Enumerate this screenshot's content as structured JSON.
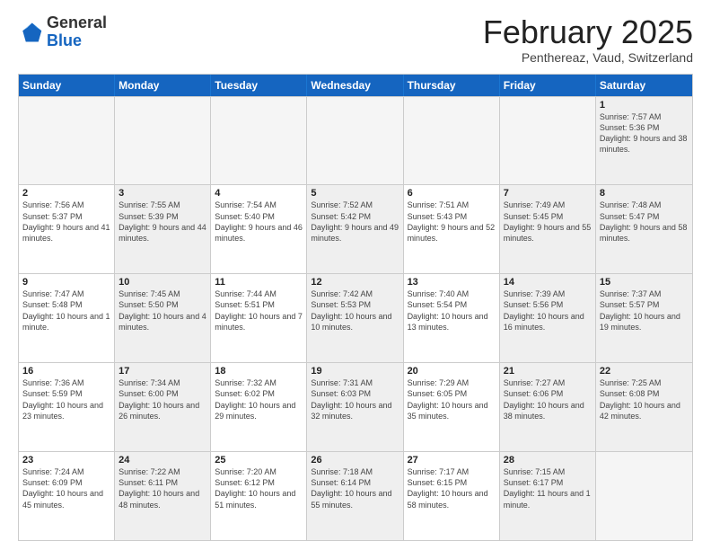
{
  "logo": {
    "general": "General",
    "blue": "Blue"
  },
  "header": {
    "title": "February 2025",
    "subtitle": "Penthereaz, Vaud, Switzerland"
  },
  "days_of_week": [
    "Sunday",
    "Monday",
    "Tuesday",
    "Wednesday",
    "Thursday",
    "Friday",
    "Saturday"
  ],
  "weeks": [
    [
      {
        "day": "",
        "info": "",
        "empty": true
      },
      {
        "day": "",
        "info": "",
        "empty": true
      },
      {
        "day": "",
        "info": "",
        "empty": true
      },
      {
        "day": "",
        "info": "",
        "empty": true
      },
      {
        "day": "",
        "info": "",
        "empty": true
      },
      {
        "day": "",
        "info": "",
        "empty": true
      },
      {
        "day": "1",
        "info": "Sunrise: 7:57 AM\nSunset: 5:36 PM\nDaylight: 9 hours and 38 minutes.",
        "shaded": true
      }
    ],
    [
      {
        "day": "2",
        "info": "Sunrise: 7:56 AM\nSunset: 5:37 PM\nDaylight: 9 hours and 41 minutes."
      },
      {
        "day": "3",
        "info": "Sunrise: 7:55 AM\nSunset: 5:39 PM\nDaylight: 9 hours and 44 minutes.",
        "shaded": true
      },
      {
        "day": "4",
        "info": "Sunrise: 7:54 AM\nSunset: 5:40 PM\nDaylight: 9 hours and 46 minutes."
      },
      {
        "day": "5",
        "info": "Sunrise: 7:52 AM\nSunset: 5:42 PM\nDaylight: 9 hours and 49 minutes.",
        "shaded": true
      },
      {
        "day": "6",
        "info": "Sunrise: 7:51 AM\nSunset: 5:43 PM\nDaylight: 9 hours and 52 minutes."
      },
      {
        "day": "7",
        "info": "Sunrise: 7:49 AM\nSunset: 5:45 PM\nDaylight: 9 hours and 55 minutes.",
        "shaded": true
      },
      {
        "day": "8",
        "info": "Sunrise: 7:48 AM\nSunset: 5:47 PM\nDaylight: 9 hours and 58 minutes.",
        "shaded": true
      }
    ],
    [
      {
        "day": "9",
        "info": "Sunrise: 7:47 AM\nSunset: 5:48 PM\nDaylight: 10 hours and 1 minute."
      },
      {
        "day": "10",
        "info": "Sunrise: 7:45 AM\nSunset: 5:50 PM\nDaylight: 10 hours and 4 minutes.",
        "shaded": true
      },
      {
        "day": "11",
        "info": "Sunrise: 7:44 AM\nSunset: 5:51 PM\nDaylight: 10 hours and 7 minutes."
      },
      {
        "day": "12",
        "info": "Sunrise: 7:42 AM\nSunset: 5:53 PM\nDaylight: 10 hours and 10 minutes.",
        "shaded": true
      },
      {
        "day": "13",
        "info": "Sunrise: 7:40 AM\nSunset: 5:54 PM\nDaylight: 10 hours and 13 minutes."
      },
      {
        "day": "14",
        "info": "Sunrise: 7:39 AM\nSunset: 5:56 PM\nDaylight: 10 hours and 16 minutes.",
        "shaded": true
      },
      {
        "day": "15",
        "info": "Sunrise: 7:37 AM\nSunset: 5:57 PM\nDaylight: 10 hours and 19 minutes.",
        "shaded": true
      }
    ],
    [
      {
        "day": "16",
        "info": "Sunrise: 7:36 AM\nSunset: 5:59 PM\nDaylight: 10 hours and 23 minutes."
      },
      {
        "day": "17",
        "info": "Sunrise: 7:34 AM\nSunset: 6:00 PM\nDaylight: 10 hours and 26 minutes.",
        "shaded": true
      },
      {
        "day": "18",
        "info": "Sunrise: 7:32 AM\nSunset: 6:02 PM\nDaylight: 10 hours and 29 minutes."
      },
      {
        "day": "19",
        "info": "Sunrise: 7:31 AM\nSunset: 6:03 PM\nDaylight: 10 hours and 32 minutes.",
        "shaded": true
      },
      {
        "day": "20",
        "info": "Sunrise: 7:29 AM\nSunset: 6:05 PM\nDaylight: 10 hours and 35 minutes."
      },
      {
        "day": "21",
        "info": "Sunrise: 7:27 AM\nSunset: 6:06 PM\nDaylight: 10 hours and 38 minutes.",
        "shaded": true
      },
      {
        "day": "22",
        "info": "Sunrise: 7:25 AM\nSunset: 6:08 PM\nDaylight: 10 hours and 42 minutes.",
        "shaded": true
      }
    ],
    [
      {
        "day": "23",
        "info": "Sunrise: 7:24 AM\nSunset: 6:09 PM\nDaylight: 10 hours and 45 minutes."
      },
      {
        "day": "24",
        "info": "Sunrise: 7:22 AM\nSunset: 6:11 PM\nDaylight: 10 hours and 48 minutes.",
        "shaded": true
      },
      {
        "day": "25",
        "info": "Sunrise: 7:20 AM\nSunset: 6:12 PM\nDaylight: 10 hours and 51 minutes."
      },
      {
        "day": "26",
        "info": "Sunrise: 7:18 AM\nSunset: 6:14 PM\nDaylight: 10 hours and 55 minutes.",
        "shaded": true
      },
      {
        "day": "27",
        "info": "Sunrise: 7:17 AM\nSunset: 6:15 PM\nDaylight: 10 hours and 58 minutes."
      },
      {
        "day": "28",
        "info": "Sunrise: 7:15 AM\nSunset: 6:17 PM\nDaylight: 11 hours and 1 minute.",
        "shaded": true
      },
      {
        "day": "",
        "info": "",
        "empty": true
      }
    ]
  ]
}
